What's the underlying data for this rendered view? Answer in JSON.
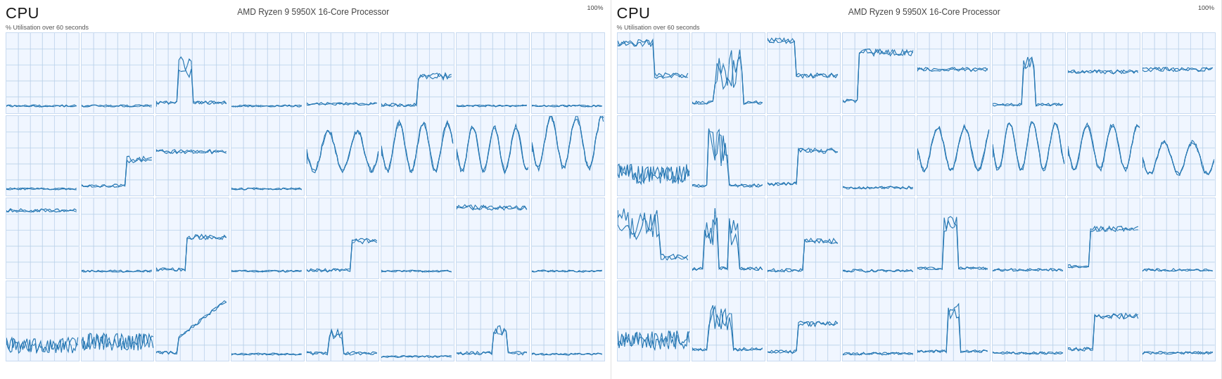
{
  "panels": [
    {
      "id": "left",
      "title": "CPU",
      "processor": "AMD Ryzen 9 5950X 16-Core Processor",
      "utilization_label": "% Utilisation over 60 seconds",
      "percent_label": "100%",
      "charts": [
        {
          "row": 0,
          "col": 0,
          "type": "flat_low"
        },
        {
          "row": 0,
          "col": 1,
          "type": "flat_low"
        },
        {
          "row": 0,
          "col": 2,
          "type": "low_spike"
        },
        {
          "row": 0,
          "col": 3,
          "type": "flat_low"
        },
        {
          "row": 0,
          "col": 4,
          "type": "flat_low2"
        },
        {
          "row": 0,
          "col": 5,
          "type": "low_rise"
        },
        {
          "row": 0,
          "col": 6,
          "type": "flat_low"
        },
        {
          "row": 0,
          "col": 7,
          "type": "flat_low"
        },
        {
          "row": 1,
          "col": 0,
          "type": "flat_low"
        },
        {
          "row": 1,
          "col": 1,
          "type": "low_dip"
        },
        {
          "row": 1,
          "col": 2,
          "type": "mid_line"
        },
        {
          "row": 1,
          "col": 3,
          "type": "flat_low"
        },
        {
          "row": 1,
          "col": 4,
          "type": "wavy_mid"
        },
        {
          "row": 1,
          "col": 5,
          "type": "wavy_high"
        },
        {
          "row": 1,
          "col": 6,
          "type": "wavy_mid2"
        },
        {
          "row": 1,
          "col": 7,
          "type": "wavy_high2"
        },
        {
          "row": 2,
          "col": 0,
          "type": "mid_flat"
        },
        {
          "row": 2,
          "col": 1,
          "type": "flat_low"
        },
        {
          "row": 2,
          "col": 2,
          "type": "low_rise2"
        },
        {
          "row": 2,
          "col": 3,
          "type": "flat_low"
        },
        {
          "row": 2,
          "col": 4,
          "type": "low_rise3"
        },
        {
          "row": 2,
          "col": 5,
          "type": "flat_low"
        },
        {
          "row": 2,
          "col": 6,
          "type": "high_flat"
        },
        {
          "row": 2,
          "col": 7,
          "type": "flat_low"
        },
        {
          "row": 3,
          "col": 0,
          "type": "noisy_low"
        },
        {
          "row": 3,
          "col": 1,
          "type": "noisy_low2"
        },
        {
          "row": 3,
          "col": 2,
          "type": "mid_rise"
        },
        {
          "row": 3,
          "col": 3,
          "type": "flat_low"
        },
        {
          "row": 3,
          "col": 4,
          "type": "low_bump"
        },
        {
          "row": 3,
          "col": 5,
          "type": "flat_vlow"
        },
        {
          "row": 3,
          "col": 6,
          "type": "low_bump2"
        },
        {
          "row": 3,
          "col": 7,
          "type": "flat_low"
        }
      ]
    },
    {
      "id": "right",
      "title": "CPU",
      "processor": "AMD Ryzen 9 5950X 16-Core Processor",
      "utilization_label": "% Utilisation over 60 seconds",
      "percent_label": "100%",
      "charts": [
        {
          "row": 0,
          "col": 0,
          "type": "r_high_start"
        },
        {
          "row": 0,
          "col": 1,
          "type": "r_spike_mid"
        },
        {
          "row": 0,
          "col": 2,
          "type": "r_high_step"
        },
        {
          "row": 0,
          "col": 3,
          "type": "r_mid_rise"
        },
        {
          "row": 0,
          "col": 4,
          "type": "r_flat_mid"
        },
        {
          "row": 0,
          "col": 5,
          "type": "r_spike_low"
        },
        {
          "row": 0,
          "col": 6,
          "type": "r_flat_mid2"
        },
        {
          "row": 0,
          "col": 7,
          "type": "r_flat_mid"
        },
        {
          "row": 1,
          "col": 0,
          "type": "r_noisy_low"
        },
        {
          "row": 1,
          "col": 1,
          "type": "r_low_spike2"
        },
        {
          "row": 1,
          "col": 2,
          "type": "r_mid_step"
        },
        {
          "row": 1,
          "col": 3,
          "type": "r_flat_low"
        },
        {
          "row": 1,
          "col": 4,
          "type": "r_wavy_mid"
        },
        {
          "row": 1,
          "col": 5,
          "type": "r_wavy_mid2"
        },
        {
          "row": 1,
          "col": 6,
          "type": "r_wavy_mid3"
        },
        {
          "row": 1,
          "col": 7,
          "type": "r_wavy_low"
        },
        {
          "row": 2,
          "col": 0,
          "type": "r_high_fall"
        },
        {
          "row": 2,
          "col": 1,
          "type": "r_spike_pair"
        },
        {
          "row": 2,
          "col": 2,
          "type": "r_low_rise"
        },
        {
          "row": 2,
          "col": 3,
          "type": "r_flat_low2"
        },
        {
          "row": 2,
          "col": 4,
          "type": "r_spike_low2"
        },
        {
          "row": 2,
          "col": 5,
          "type": "r_flat_low3"
        },
        {
          "row": 2,
          "col": 6,
          "type": "r_step_up"
        },
        {
          "row": 2,
          "col": 7,
          "type": "r_flat_low4"
        },
        {
          "row": 3,
          "col": 0,
          "type": "r_noisy_low2"
        },
        {
          "row": 3,
          "col": 1,
          "type": "r_mid_bump"
        },
        {
          "row": 3,
          "col": 2,
          "type": "r_low_step"
        },
        {
          "row": 3,
          "col": 3,
          "type": "r_flat_low5"
        },
        {
          "row": 3,
          "col": 4,
          "type": "r_spike_low3"
        },
        {
          "row": 3,
          "col": 5,
          "type": "r_flat_low6"
        },
        {
          "row": 3,
          "col": 6,
          "type": "r_step_up2"
        },
        {
          "row": 3,
          "col": 7,
          "type": "r_flat_low7"
        }
      ]
    }
  ]
}
